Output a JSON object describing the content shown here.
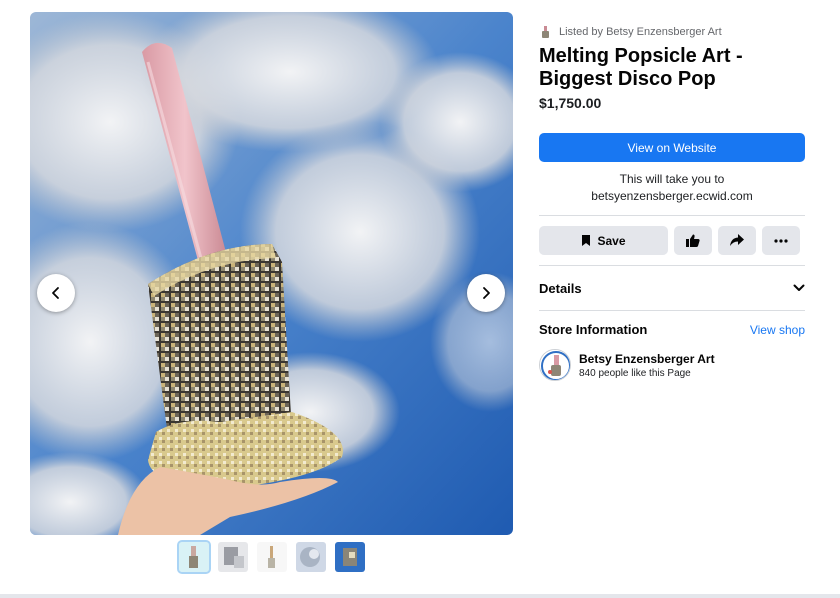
{
  "listing": {
    "seller_text": "Listed by Betsy Enzensberger Art",
    "title_line1": "Melting Popsicle Art -",
    "title_line2": "Biggest Disco Pop",
    "price": "$1,750.00"
  },
  "cta": {
    "view_website_label": "View on Website",
    "redirect_line1": "This will take you to",
    "redirect_line2": "betsyenzensberger.ecwid.com"
  },
  "actions": {
    "save_label": "Save",
    "icons": [
      "bookmark-icon",
      "thumbs-up-icon",
      "share-icon",
      "more-icon"
    ]
  },
  "details": {
    "label": "Details",
    "icon": "chevron-down-icon"
  },
  "store": {
    "heading": "Store Information",
    "view_shop_label": "View shop",
    "name": "Betsy Enzensberger Art",
    "likes": "840 people like this Page"
  },
  "gallery": {
    "thumbnail_count": 5,
    "active_index": 0,
    "icons": [
      "chevron-left-icon",
      "chevron-right-icon"
    ]
  },
  "colors": {
    "accent": "#1877f2",
    "button_gray": "#e4e6eb",
    "sky_blue": "#2f6fc4"
  }
}
